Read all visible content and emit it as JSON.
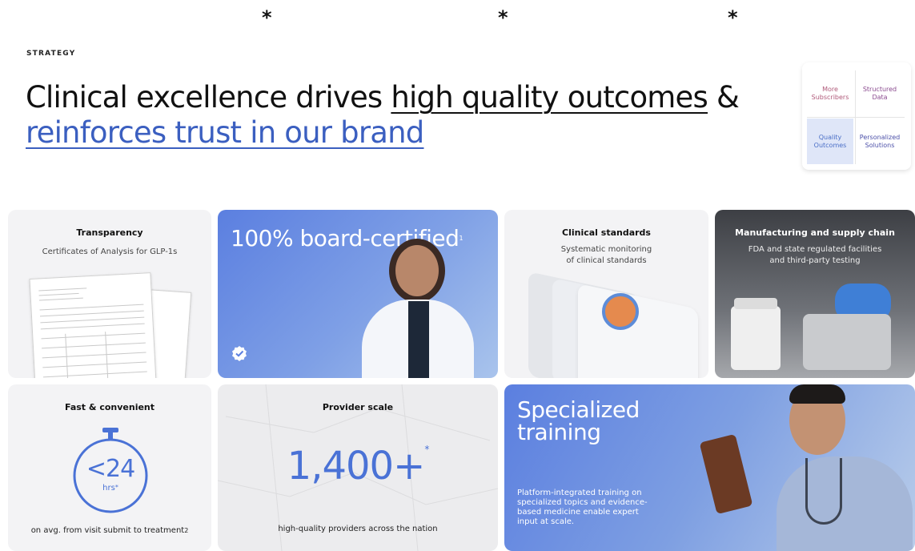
{
  "asterisks": [
    "*",
    "*",
    "*"
  ],
  "eyebrow": "STRATEGY",
  "headline": {
    "part1": "Clinical excellence drives ",
    "underline1": "high quality outcomes",
    "part2": " &",
    "underline2": "reinforces trust in our brand"
  },
  "matrix": {
    "cells": [
      {
        "label": "More Subscribers",
        "color": "#b05a7a"
      },
      {
        "label": "Structured Data",
        "color": "#8a4a8f"
      },
      {
        "label": "Quality Outcomes",
        "color": "#4b6fc7",
        "highlight": "#dfe6f8"
      },
      {
        "label": "Personalized Solutions",
        "color": "#4b4fa8"
      }
    ]
  },
  "cards": {
    "transparency": {
      "title": "Transparency",
      "subtitle": "Certificates of Analysis for GLP-1s"
    },
    "board": {
      "title": "100% board-certified",
      "sup": "1"
    },
    "clinical": {
      "title": "Clinical standards",
      "subtitle_line1": "Systematic monitoring",
      "subtitle_line2": "of clinical standards"
    },
    "manufacturing": {
      "title": "Manufacturing and supply chain",
      "subtitle_line1": "FDA and state regulated facilities",
      "subtitle_line2": "and third-party testing"
    },
    "fast": {
      "title": "Fast & convenient",
      "number": "<24",
      "unit": "hrs",
      "unit_sup": "*",
      "caption": "on avg. from visit submit to treatment",
      "caption_sup": "2"
    },
    "provider": {
      "title": "Provider scale",
      "number": "1,400+",
      "sup": "*",
      "caption": "high-quality providers across the nation"
    },
    "training": {
      "title_line1": "Specialized",
      "title_line2": "training",
      "body": "Platform-integrated training on specialized topics and evidence-based medicine enable expert input at scale."
    }
  },
  "colors": {
    "accent": "#3b5fc0",
    "card_gray": "#f3f3f5",
    "blue_gradient_start": "#5b7fe0",
    "blue_gradient_end": "#8fb1e8"
  }
}
